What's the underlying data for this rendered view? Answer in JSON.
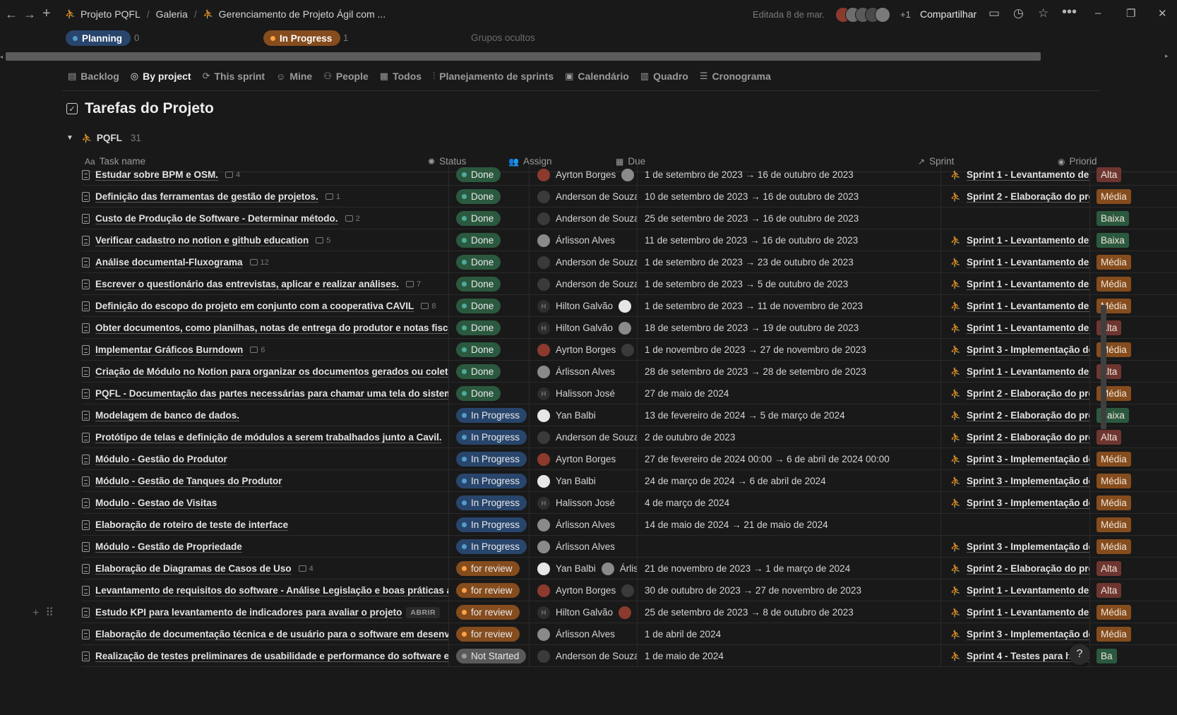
{
  "breadcrumb": {
    "workspace": "Projeto PQFL",
    "gallery": "Galeria",
    "page": "Gerenciamento de Projeto Ágil com ..."
  },
  "topbar": {
    "edited": "Editada 8 de mar.",
    "extra_people": "+1",
    "share": "Compartilhar"
  },
  "groups": {
    "planning": {
      "label": "Planning",
      "count": "0"
    },
    "in_progress": {
      "label": "In Progress",
      "count": "1"
    },
    "hidden": "Grupos ocultos"
  },
  "tabs": [
    {
      "label": "Backlog",
      "icon": "stack-icon"
    },
    {
      "label": "By project",
      "icon": "target-icon"
    },
    {
      "label": "This sprint",
      "icon": "cycle-icon"
    },
    {
      "label": "Mine",
      "icon": "person-icon"
    },
    {
      "label": "People",
      "icon": "people-icon"
    },
    {
      "label": "Todos",
      "icon": "table-icon"
    },
    {
      "label": "Planejamento de sprints",
      "icon": "board-icon"
    },
    {
      "label": "Calendário",
      "icon": "calendar-icon"
    },
    {
      "label": "Quadro",
      "icon": "columns-icon"
    },
    {
      "label": "Cronograma",
      "icon": "timeline-icon"
    }
  ],
  "database": {
    "title": "Tarefas do Projeto"
  },
  "group": {
    "name": "PQFL",
    "count": "31"
  },
  "columns": {
    "name": "Task name",
    "name_prefix": "Aa",
    "status": "Status",
    "assign": "Assign",
    "due": "Due",
    "sprint": "Sprint",
    "priority": "Priorid"
  },
  "open_label": "ABRIR",
  "colors": {
    "done": "#2b593f",
    "done_dot": "#4dab9a",
    "in_progress": "#28456c",
    "in_progress_dot": "#529cca",
    "for_review": "#854c1d",
    "for_review_dot": "#ffa344",
    "not_started": "#5a5a5a",
    "not_started_dot": "#9b9b9b",
    "alta": "#6e3630",
    "media": "#854c1d",
    "baixa": "#2b593f"
  },
  "rows": [
    {
      "name": "Estudar sobre BPM e OSM.",
      "comments": "4",
      "status": "Done",
      "people": [
        [
          "Ayrton Borges",
          "red"
        ],
        [
          "A",
          "photo"
        ]
      ],
      "due": "1 de setembro de 2023 → 16 de outubro de 2023",
      "sprint": "Sprint 1 - Levantamento de R",
      "priority": "Alta"
    },
    {
      "name": "Definição das ferramentas de gestão de projetos.",
      "comments": "1",
      "status": "Done",
      "people": [
        [
          "Anderson de Souza L",
          "dark"
        ]
      ],
      "due": "10 de setembro de 2023 → 16 de outubro de 2023",
      "sprint": "Sprint 2 - Elaboração do proj",
      "priority": "Média"
    },
    {
      "name": "Custo de Produção de Software - Determinar método.",
      "comments": "2",
      "status": "Done",
      "people": [
        [
          "Anderson de Souza L",
          "dark"
        ]
      ],
      "due": "25 de setembro de 2023 → 16 de outubro de 2023",
      "sprint": "",
      "priority": "Baixa"
    },
    {
      "name": "Verificar cadastro no notion e github education",
      "comments": "5",
      "status": "Done",
      "people": [
        [
          "Árlisson Alves",
          "photo"
        ]
      ],
      "due": "11 de setembro de 2023 → 16 de outubro de 2023",
      "sprint": "Sprint 1 - Levantamento de R",
      "priority": "Baixa"
    },
    {
      "name": "Análise documental-Fluxograma",
      "comments": "12",
      "status": "Done",
      "people": [
        [
          "Anderson de Souza L",
          "dark"
        ]
      ],
      "due": "1 de setembro de 2023 → 23 de outubro de 2023",
      "sprint": "Sprint 1 - Levantamento de R",
      "priority": "Média"
    },
    {
      "name": "Escrever o questionário das entrevistas, aplicar e realizar análises.",
      "comments": "7",
      "status": "Done",
      "people": [
        [
          "Anderson de Souza L",
          "dark"
        ]
      ],
      "due": "1 de setembro de 2023 → 5 de outubro de 2023",
      "sprint": "Sprint 1 - Levantamento de R",
      "priority": "Média"
    },
    {
      "name": "Definição do escopo do projeto em conjunto com a cooperativa CAVIL",
      "comments": "8",
      "status": "Done",
      "people": [
        [
          "Hilton Galvão",
          "H"
        ],
        [
          "Ya",
          "bw"
        ]
      ],
      "due": "1 de setembro de 2023 → 11 de novembro de 2023",
      "sprint": "Sprint 1 - Levantamento de R",
      "priority": "Média"
    },
    {
      "name": "Obter documentos, como planilhas, notas de entrega do produtor e notas fiscais",
      "comments": "",
      "status": "Done",
      "people": [
        [
          "Hilton Galvão",
          "H"
        ],
        [
          "Ár",
          "photo"
        ]
      ],
      "due": "18 de setembro de 2023 → 19 de outubro de 2023",
      "sprint": "Sprint 1 - Levantamento de R",
      "priority": "Alta"
    },
    {
      "name": "Implementar Gráficos Burndown",
      "comments": "6",
      "status": "Done",
      "people": [
        [
          "Ayrton Borges",
          "red"
        ],
        [
          "A",
          "dark"
        ]
      ],
      "due": "1 de novembro de 2023 → 27 de novembro de 2023",
      "sprint": "Sprint 3 - Implementação do",
      "priority": "Média"
    },
    {
      "name": "Criação de Módulo no Notion para organizar os documentos gerados ou coletados",
      "comments": "",
      "status": "Done",
      "people": [
        [
          "Árlisson Alves",
          "photo"
        ]
      ],
      "due": "28 de setembro de 2023 → 28 de setembro de 2023",
      "sprint": "Sprint 1 - Levantamento de R",
      "priority": "Alta"
    },
    {
      "name": "PQFL - Documentação das partes necessárias para chamar uma tela do sistema",
      "comments": "",
      "status": "Done",
      "people": [
        [
          "Halisson José",
          "H"
        ]
      ],
      "due": "27 de maio de 2024",
      "sprint": "Sprint 2 - Elaboração do proj",
      "priority": "Média"
    },
    {
      "name": "Modelagem de banco de dados.",
      "comments": "",
      "status": "In Progress",
      "people": [
        [
          "Yan Balbi",
          "bw"
        ]
      ],
      "due": "13 de fevereiro de 2024 → 5 de março de 2024",
      "sprint": "Sprint 2 - Elaboração do proj",
      "priority": "Baixa"
    },
    {
      "name": "Protótipo de telas e definição de módulos a serem trabalhados junto a Cavil.",
      "comments": "",
      "status": "In Progress",
      "people": [
        [
          "Anderson de Souza L",
          "dark"
        ]
      ],
      "due": "2 de outubro de 2023",
      "sprint": "Sprint 2 - Elaboração do proj",
      "priority": "Alta"
    },
    {
      "name": "Módulo - Gestão do Produtor",
      "comments": "",
      "status": "In Progress",
      "people": [
        [
          "Ayrton Borges",
          "red"
        ]
      ],
      "due": "27 de fevereiro de 2024 00:00 → 6 de abril de 2024 00:00",
      "sprint": "Sprint 3 - Implementação do",
      "priority": "Média"
    },
    {
      "name": "Módulo - Gestão de Tanques do Produtor",
      "comments": "",
      "status": "In Progress",
      "people": [
        [
          "Yan Balbi",
          "bw"
        ]
      ],
      "due": "24 de março de 2024 → 6 de abril de 2024",
      "sprint": "Sprint 3 - Implementação do",
      "priority": "Média"
    },
    {
      "name": "Modulo - Gestao de Visitas",
      "comments": "",
      "status": "In Progress",
      "people": [
        [
          "Halisson José",
          "H"
        ]
      ],
      "due": "4 de março de 2024",
      "sprint": "Sprint 3 - Implementação do",
      "priority": "Média"
    },
    {
      "name": "Elaboração de roteiro de teste de interface",
      "comments": "",
      "status": "In Progress",
      "people": [
        [
          "Árlisson Alves",
          "photo"
        ]
      ],
      "due": "14 de maio de 2024 → 21 de maio de 2024",
      "sprint": "",
      "priority": "Média"
    },
    {
      "name": "Módulo - Gestão de Propriedade",
      "comments": "",
      "status": "In Progress",
      "people": [
        [
          "Árlisson Alves",
          "photo"
        ]
      ],
      "due": "",
      "sprint": "Sprint 3 - Implementação do",
      "priority": "Média"
    },
    {
      "name": "Elaboração de Diagramas de Casos de Uso",
      "comments": "4",
      "status": "for review",
      "people": [
        [
          "Yan Balbi",
          "bw"
        ],
        [
          "Árlisso",
          "photo"
        ]
      ],
      "due": "21 de novembro de 2023 → 1 de março de 2024",
      "sprint": "Sprint 2 - Elaboração do proj",
      "priority": "Alta"
    },
    {
      "name": "Levantamento de requisitos do software - Análise Legislação e boas práticas agropecuárias",
      "comments": "",
      "status": "for review",
      "people": [
        [
          "Ayrton Borges",
          "red"
        ],
        [
          "A",
          "dark"
        ]
      ],
      "due": "30 de outubro de 2023 → 27 de novembro de 2023",
      "sprint": "Sprint 1 - Levantamento de R",
      "priority": "Alta"
    },
    {
      "name": "Estudo KPI para levantamento de indicadores para avaliar o projeto",
      "comments": "",
      "open": true,
      "status": "for review",
      "people": [
        [
          "Hilton Galvão",
          "H"
        ],
        [
          "Ay",
          "red"
        ]
      ],
      "due": "25 de setembro de 2023 → 8 de outubro de 2023",
      "sprint": "Sprint 1 - Levantamento de R",
      "priority": "Média"
    },
    {
      "name": "Elaboração de documentação técnica e de usuário para o software em desenvolvimento",
      "comments": "",
      "status": "for review",
      "people": [
        [
          "Árlisson Alves",
          "photo"
        ]
      ],
      "due": "1 de abril de 2024",
      "sprint": "Sprint 3 - Implementação do",
      "priority": "Média"
    },
    {
      "name": "Realização de testes preliminares de usabilidade e performance do software e ajustes",
      "comments": "",
      "status": "Not Started",
      "people": [
        [
          "Anderson de Souza L",
          "dark"
        ]
      ],
      "due": "1 de maio de 2024",
      "sprint": "Sprint 4 - Testes para homolo",
      "priority": "Ba"
    }
  ]
}
